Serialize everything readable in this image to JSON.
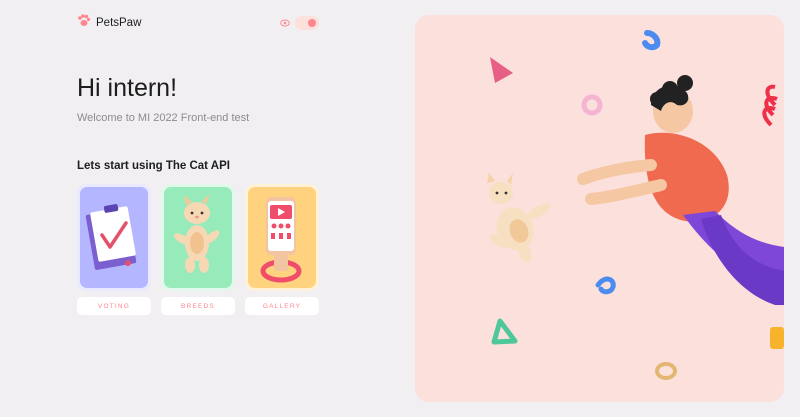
{
  "header": {
    "logo_text": "PetsPaw",
    "logo_icon": "paw-icon",
    "theme_icon": "eye-icon",
    "theme_toggle_on": true
  },
  "main": {
    "greeting": "Hi intern!",
    "subtitle": "Welcome to MI 2022 Front-end test",
    "section_title": "Lets start using The Cat API",
    "cards": [
      {
        "label": "VOTING",
        "icon": "vote-table-icon",
        "color": "#b4b7ff"
      },
      {
        "label": "BREEDS",
        "icon": "pet-breeds-icon",
        "color": "#97eab9"
      },
      {
        "label": "GALLERY",
        "icon": "images-search-icon",
        "color": "#ffd280"
      }
    ]
  },
  "hero": {
    "background_color": "#fbe0dc",
    "illustration": "girl-and-pet-illustration"
  },
  "colors": {
    "accent": "#ff868e",
    "page_bg": "#f1eff2"
  }
}
